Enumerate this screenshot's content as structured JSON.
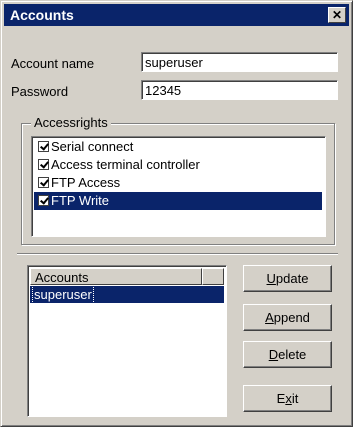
{
  "window": {
    "title": "Accounts",
    "close_symbol": "✕"
  },
  "form": {
    "account_name_label": "Account name",
    "account_name_value": "superuser",
    "password_label": "Password",
    "password_value": "12345"
  },
  "access_rights": {
    "legend": "Accessrights",
    "items": [
      {
        "label": "Serial connect",
        "checked": true,
        "selected": false
      },
      {
        "label": "Access terminal controller",
        "checked": true,
        "selected": false
      },
      {
        "label": "FTP Access",
        "checked": true,
        "selected": false
      },
      {
        "label": "FTP Write",
        "checked": true,
        "selected": true
      }
    ]
  },
  "accounts_table": {
    "header": "Accounts",
    "rows": [
      "superuser"
    ]
  },
  "buttons": {
    "update": {
      "mnemonic": "U",
      "rest": "pdate"
    },
    "append": {
      "mnemonic": "A",
      "rest": "ppend"
    },
    "delete": {
      "mnemonic": "D",
      "rest": "elete"
    },
    "exit": {
      "pre": "E",
      "mnemonic": "x",
      "rest": "it"
    }
  },
  "colors": {
    "title_bar": "#0a246a",
    "face": "#d4d0c8",
    "selection": "#0a246a"
  }
}
